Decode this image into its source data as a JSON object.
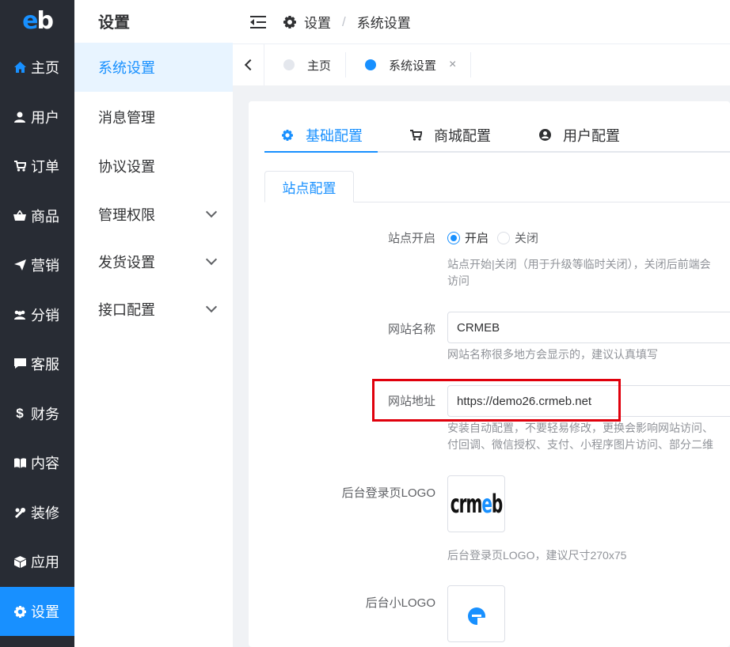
{
  "nav": {
    "logo": "eb",
    "items": [
      {
        "label": "主页",
        "icon": "home-icon"
      },
      {
        "label": "用户",
        "icon": "user-icon"
      },
      {
        "label": "订单",
        "icon": "cart-icon"
      },
      {
        "label": "商品",
        "icon": "basket-icon"
      },
      {
        "label": "营销",
        "icon": "send-icon"
      },
      {
        "label": "分销",
        "icon": "group-icon"
      },
      {
        "label": "客服",
        "icon": "chat-icon"
      },
      {
        "label": "财务",
        "icon": "dollar-icon"
      },
      {
        "label": "内容",
        "icon": "book-icon"
      },
      {
        "label": "装修",
        "icon": "tools-icon"
      },
      {
        "label": "应用",
        "icon": "cube-icon"
      },
      {
        "label": "设置",
        "icon": "gear-icon"
      }
    ],
    "active_index": 11
  },
  "submenu": {
    "title": "设置",
    "items": [
      {
        "label": "系统设置",
        "expandable": false
      },
      {
        "label": "消息管理",
        "expandable": false
      },
      {
        "label": "协议设置",
        "expandable": false
      },
      {
        "label": "管理权限",
        "expandable": true
      },
      {
        "label": "发货设置",
        "expandable": true
      },
      {
        "label": "接口配置",
        "expandable": true
      }
    ]
  },
  "header": {
    "breadcrumb": [
      "设置",
      "系统设置"
    ],
    "separator": "/"
  },
  "tabs": [
    {
      "label": "主页",
      "active": false
    },
    {
      "label": "系统设置",
      "active": true,
      "close": "×"
    }
  ],
  "main_tabs": [
    {
      "label": "基础配置",
      "icon": "gear-icon",
      "active": true
    },
    {
      "label": "商城配置",
      "icon": "cart-icon",
      "active": false
    },
    {
      "label": "用户配置",
      "icon": "account-icon",
      "active": false
    }
  ],
  "sub_tab": "站点配置",
  "form": {
    "site_open": {
      "label": "站点开启",
      "options": [
        "开启",
        "关闭"
      ],
      "selected": "开启",
      "help_line1": "站点开始|关闭（用于升级等临时关闭），关闭后前端会",
      "help_line2": "访问"
    },
    "site_name": {
      "label": "网站名称",
      "value": "CRMEB",
      "help": "网站名称很多地方会显示的，建议认真填写"
    },
    "site_url": {
      "label": "网站地址",
      "value": "https://demo26.crmeb.net",
      "help_line1": "安装自动配置，不要轻易修改，更换会影响网站访问、",
      "help_line2": "付回调、微信授权、支付、小程序图片访问、部分二维"
    },
    "admin_login_logo": {
      "label": "后台登录页LOGO",
      "image_text": "crmeb",
      "help": "后台登录页LOGO，建议尺寸270x75"
    },
    "admin_small_logo": {
      "label": "后台小LOGO"
    }
  },
  "colors": {
    "accent": "#1890ff",
    "nav_bg": "#282c34",
    "highlight": "#e0000c"
  }
}
